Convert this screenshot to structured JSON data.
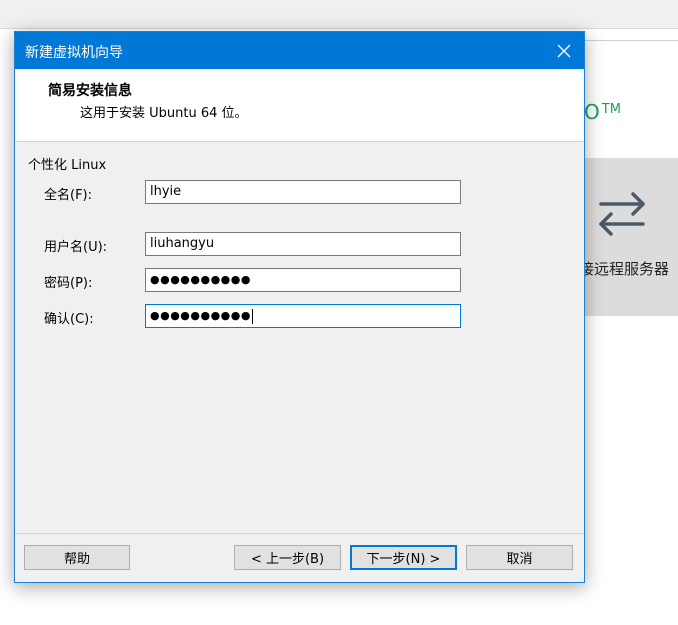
{
  "background": {
    "logo_suffix": "O",
    "logo_tm": "TM",
    "remote_tile_label": "接远程服务器",
    "remote_icon": "swap-arrows-icon"
  },
  "dialog": {
    "title": "新建虚拟机向导",
    "close_icon": "close-icon",
    "header_title": "简易安装信息",
    "header_subtitle": "这用于安装 Ubuntu 64 位。",
    "group_label": "个性化 Linux",
    "fields": {
      "fullname": {
        "label": "全名(F):",
        "value": "lhyie"
      },
      "username": {
        "label": "用户名(U):",
        "value": "liuhangyu"
      },
      "password": {
        "label": "密码(P):",
        "value": "●●●●●●●●●●"
      },
      "confirm": {
        "label": "确认(C):",
        "value": "●●●●●●●●●●"
      }
    },
    "buttons": {
      "help": "帮助",
      "back": "< 上一步(B)",
      "next": "下一步(N) >",
      "cancel": "取消"
    }
  },
  "colors": {
    "titlebar": "#0078d7",
    "dialog_bg": "#f0f0f0",
    "logo_green": "#1e9e5a"
  }
}
